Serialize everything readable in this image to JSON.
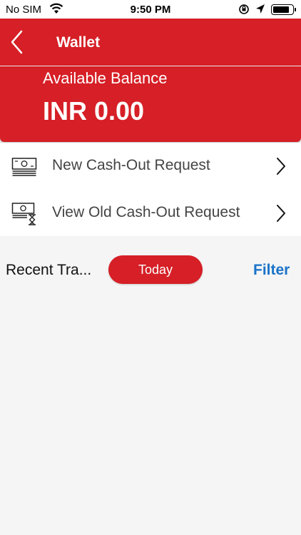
{
  "status_bar": {
    "carrier": "No SIM",
    "time": "9:50 PM",
    "wifi_icon": "wifi-icon",
    "rotation_lock_icon": "rotation-lock-icon",
    "location_icon": "location-arrow-icon",
    "battery_icon": "battery-icon"
  },
  "nav": {
    "title": "Wallet",
    "back_icon": "chevron-left-icon"
  },
  "balance": {
    "label": "Available Balance",
    "amount": "INR 0.00"
  },
  "menu": {
    "items": [
      {
        "label": "New Cash-Out Request",
        "icon": "cash-stack-icon"
      },
      {
        "label": "View Old Cash-Out Request",
        "icon": "cash-history-icon"
      }
    ]
  },
  "recent": {
    "label": "Recent Tra...",
    "today_label": "Today",
    "filter_label": "Filter"
  },
  "colors": {
    "brand_red": "#d61f26",
    "link_blue": "#1a73c9",
    "background": "#f5f5f5"
  }
}
